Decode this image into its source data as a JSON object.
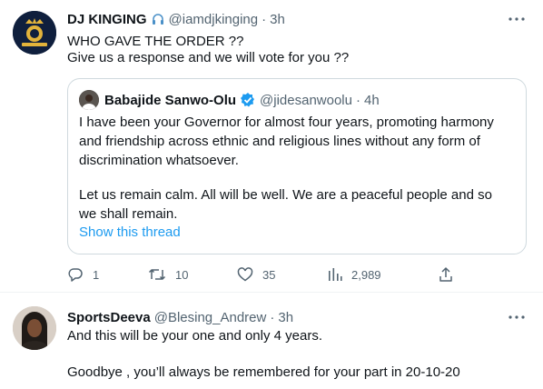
{
  "tweets": [
    {
      "name": "DJ KINGING",
      "handle": "@iamdjkinging",
      "time": "3h",
      "dot": "·",
      "lines": [
        "WHO GAVE THE ORDER ??",
        "Give us a response and we will vote for you ??"
      ],
      "quote": {
        "name": "Babajide Sanwo-Olu",
        "handle": "@jidesanwoolu",
        "time": "4h",
        "dot": "·",
        "lines": [
          "I have been your Governor for almost four years, promoting harmony",
          "and friendship across ethnic and religious lines without any form of",
          "discrimination whatsoever.",
          "",
          "Let us remain calm. All will be well. We are a peaceful people and so",
          "we shall remain."
        ],
        "link_label": "Show this thread"
      },
      "actions": {
        "replies": "1",
        "retweets": "10",
        "likes": "35",
        "views": "2,989"
      }
    },
    {
      "name": "SportsDeeva",
      "handle": "@Blesing_Andrew",
      "time": "3h",
      "dot": "·",
      "lines": [
        "And this will be your one and only 4 years.",
        "",
        "Goodbye , you’ll always be remembered for your part in 20-10-20"
      ]
    }
  ],
  "colors": {
    "text": "#0f1419",
    "secondary": "#536471",
    "link": "#1d9bf0",
    "border": "#cfd9de"
  },
  "icons": [
    "headphones-icon",
    "more-icon",
    "verified-badge-icon",
    "reply-icon",
    "retweet-icon",
    "like-icon",
    "views-icon",
    "share-icon"
  ]
}
